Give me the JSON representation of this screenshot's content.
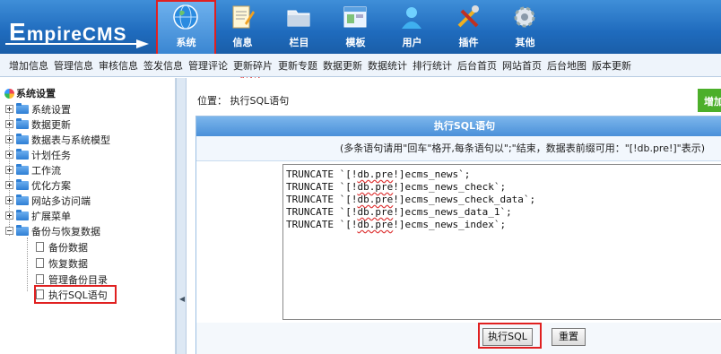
{
  "header": {
    "logo": "EmpireCMS",
    "menu": [
      {
        "label": "系统",
        "icon": "globe-icon",
        "active": true
      },
      {
        "label": "信息",
        "icon": "notepad-icon",
        "active": false
      },
      {
        "label": "栏目",
        "icon": "folder-icon",
        "active": false
      },
      {
        "label": "模板",
        "icon": "window-icon",
        "active": false
      },
      {
        "label": "用户",
        "icon": "user-icon",
        "active": false
      },
      {
        "label": "插件",
        "icon": "tools-icon",
        "active": false
      },
      {
        "label": "其他",
        "icon": "gear-icon",
        "active": false
      }
    ]
  },
  "quicknav": [
    "增加信息",
    "管理信息",
    "审核信息",
    "签发信息",
    "管理评论",
    "更新碎片",
    "更新专题",
    "数据更新",
    "数据统计",
    "排行统计",
    "后台首页",
    "网站首页",
    "后台地图",
    "版本更新"
  ],
  "sidebar": {
    "title": "系统设置",
    "items": [
      "系统设置",
      "数据更新",
      "数据表与系统模型",
      "计划任务",
      "工作流",
      "优化方案",
      "网站多访问端",
      "扩展菜单",
      "备份与恢复数据"
    ],
    "subitems": [
      "备份数据",
      "恢复数据",
      "管理备份目录",
      "执行SQL语句"
    ]
  },
  "main": {
    "location_label": "位置：",
    "location_value": "执行SQL语句",
    "add_button": "增加",
    "panel_title": "执行SQL语句",
    "note": "(多条语句请用\"回车\"格开,每条语句以\";\"结束，数据表前缀可用：\"[!db.pre!]\"表示)",
    "sql_lines": [
      {
        "pre": "TRUNCATE `[!",
        "dbpre": "db.pre",
        "post": "!]ecms_news`;"
      },
      {
        "pre": "TRUNCATE `[!",
        "dbpre": "db.pre",
        "post": "!]ecms_news_check`;"
      },
      {
        "pre": "TRUNCATE `[!",
        "dbpre": "db.pre",
        "post": "!]ecms_news_check_data`;"
      },
      {
        "pre": "TRUNCATE `[!",
        "dbpre": "db.pre",
        "post": "!]ecms_news_data_1`;"
      },
      {
        "pre": "TRUNCATE `[!",
        "dbpre": "db.pre",
        "post": "!]ecms_news_index`;"
      }
    ],
    "execute_button": "执行SQL",
    "reset_button": "重置"
  },
  "annotations": {
    "step1": "①",
    "step2": "②",
    "step3": "③"
  },
  "colors": {
    "header_blue": "#1f6bbd",
    "highlight_red": "#e02020",
    "add_green": "#4caf2a"
  }
}
